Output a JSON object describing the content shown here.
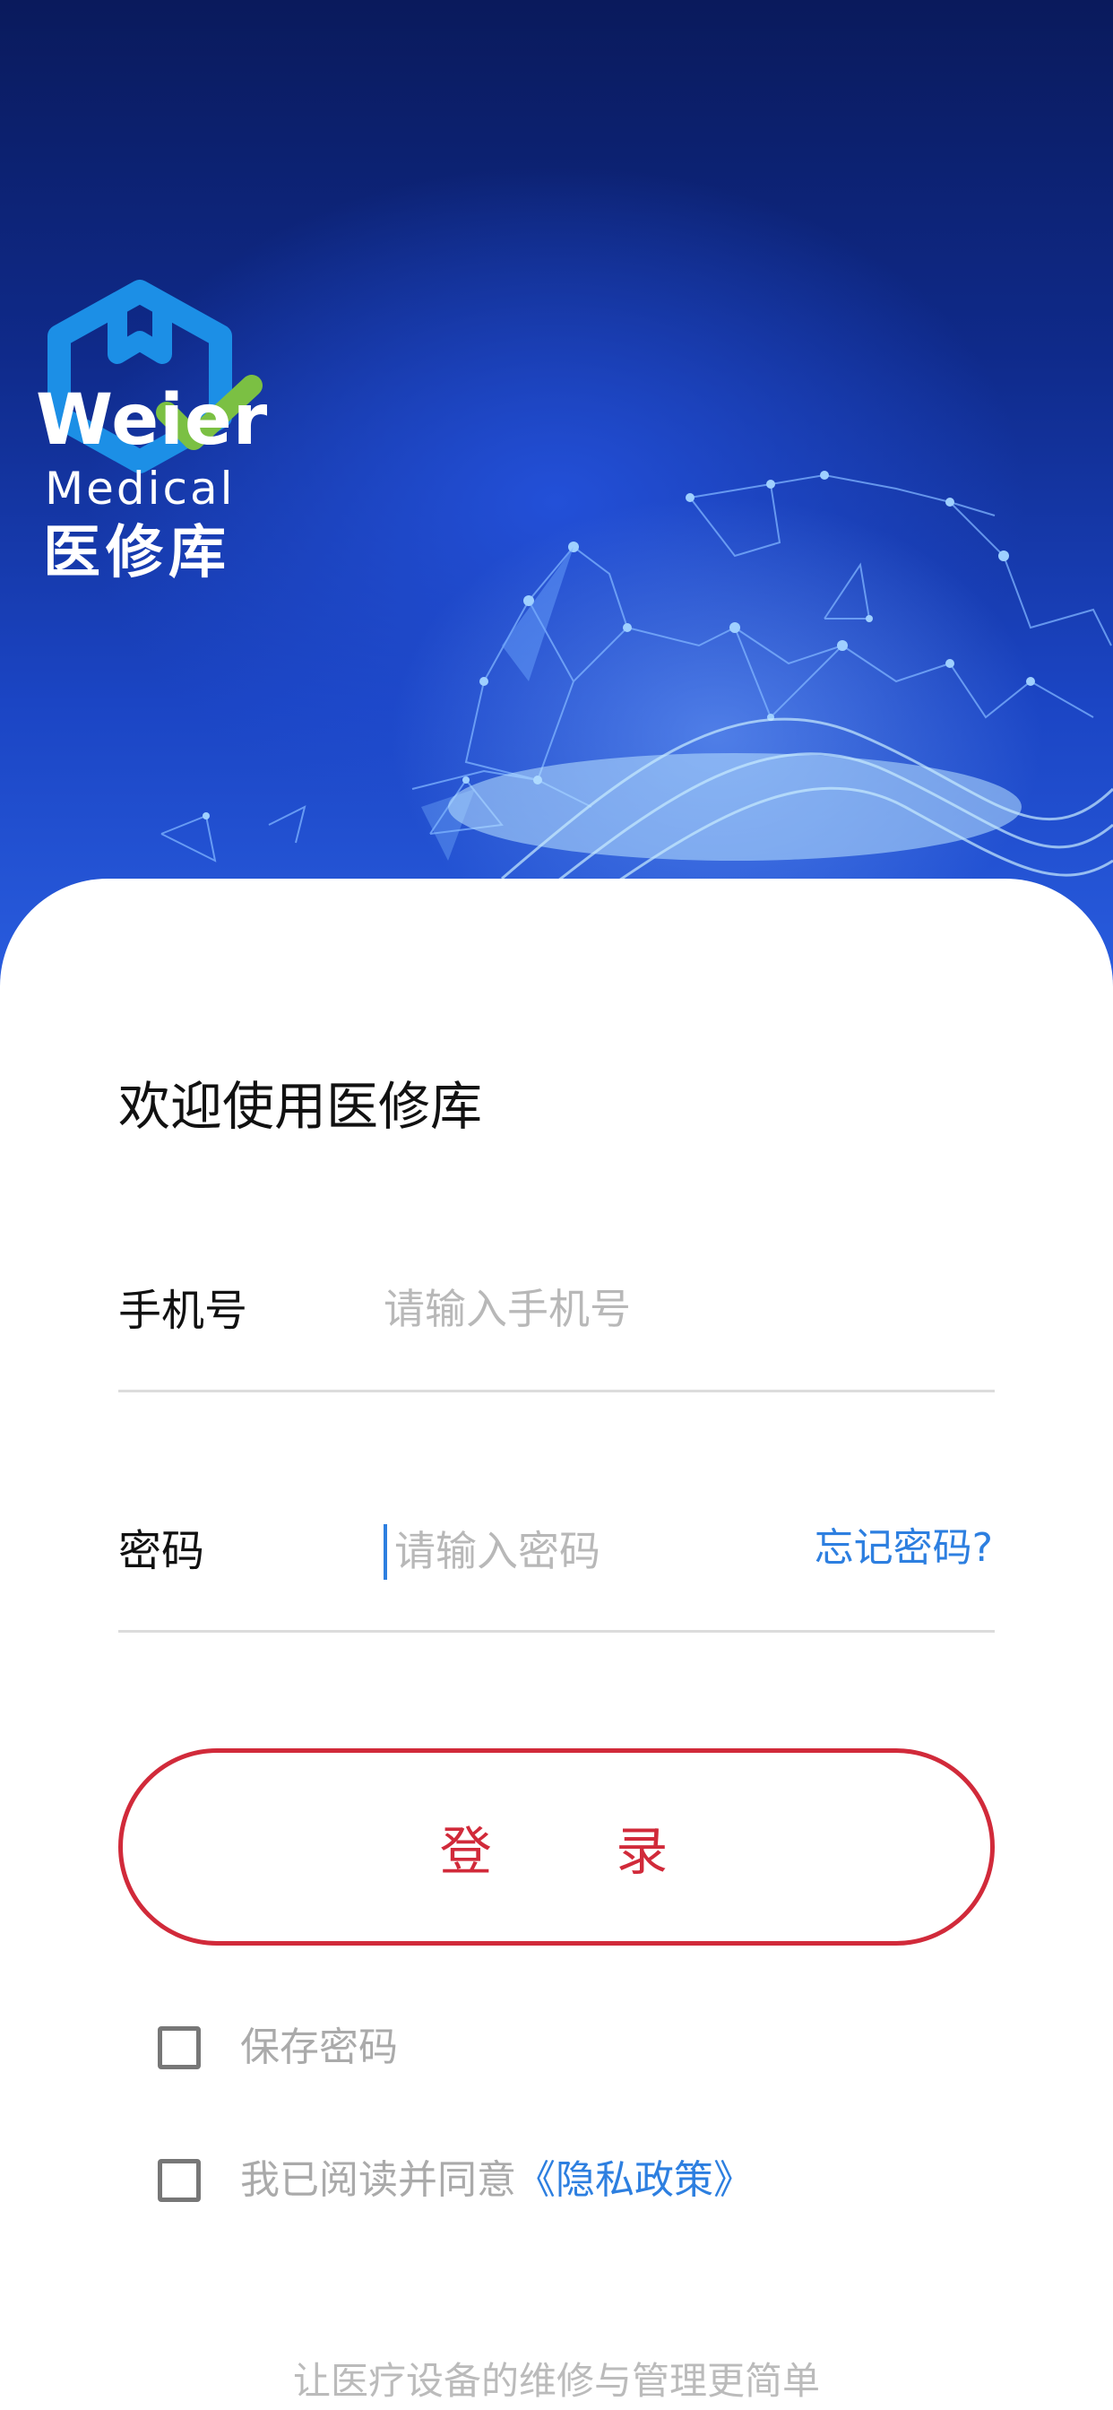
{
  "brand": {
    "logo_word": "Weier",
    "logo_sub": "Medical",
    "logo_cn": "医修库",
    "colors": {
      "logo_blue": "#1c8fe6",
      "logo_green": "#7bc043",
      "accent_red": "#d12a3a",
      "link_blue": "#2d7fe0"
    }
  },
  "login": {
    "welcome": "欢迎使用医修库",
    "phone_label": "手机号",
    "phone_placeholder": "请输入手机号",
    "phone_value": "",
    "password_label": "密码",
    "password_placeholder": "请输入密码",
    "password_value": "",
    "forgot_password": "忘记密码?",
    "submit_label": "登 录",
    "remember_password": "保存密码",
    "remember_checked": false,
    "agree_text": "我已阅读并同意",
    "privacy_link": "《隐私政策》",
    "agree_checked": false
  },
  "footer": {
    "slogan": "让医疗设备的维修与管理更简单"
  }
}
